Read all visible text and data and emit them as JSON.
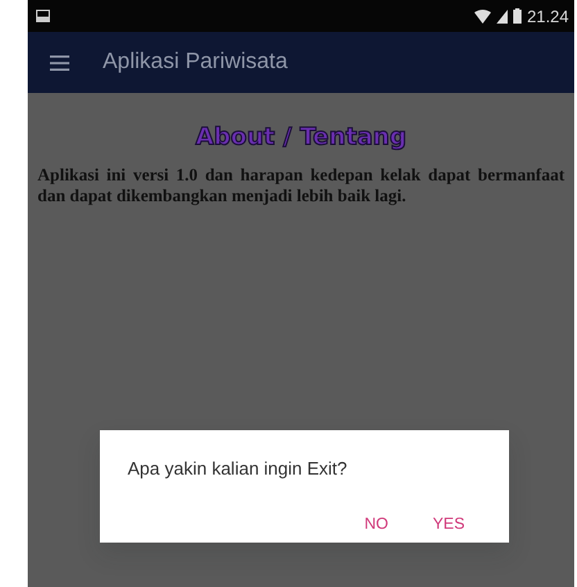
{
  "status_bar": {
    "time": "21.24"
  },
  "app_bar": {
    "title": "Aplikasi Pariwisata"
  },
  "content": {
    "heading": "About / Tentang",
    "text": "Aplikasi ini versi 1.0 dan harapan kedepan kelak dapat bermanfaat dan dapat dikembangkan menjadi lebih baik lagi."
  },
  "dialog": {
    "message": "Apa yakin kalian ingin Exit?",
    "buttons": [
      "NO",
      "YES"
    ]
  }
}
